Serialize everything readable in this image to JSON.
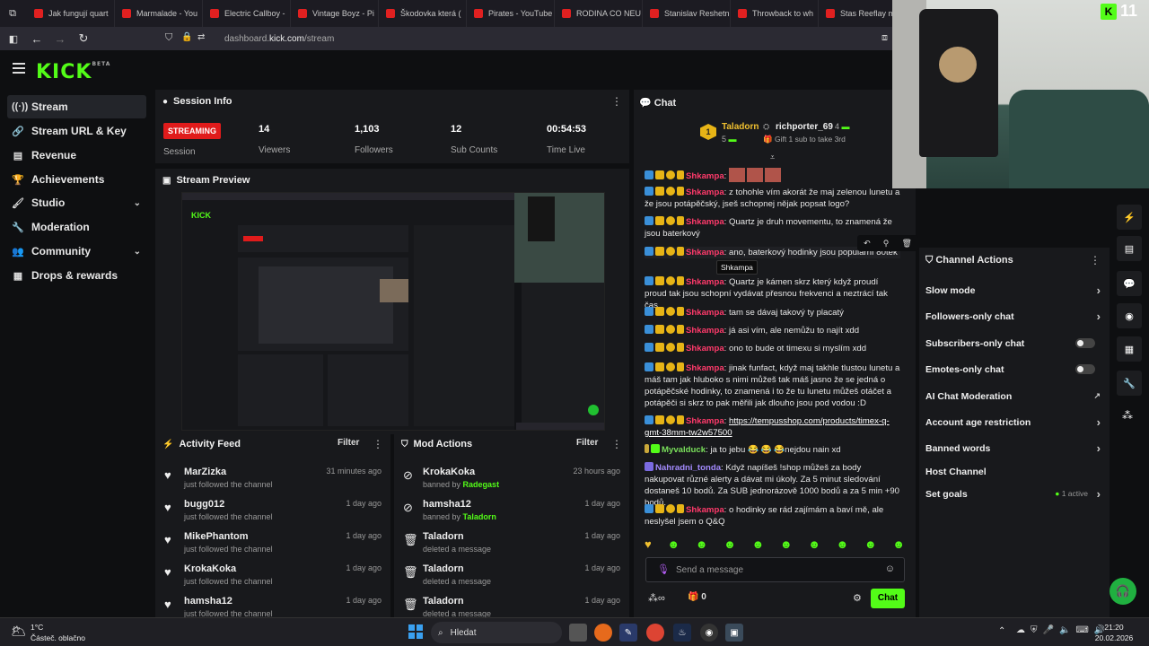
{
  "tabs": [
    {
      "label": "Jak fungují quart",
      "color": "#e02020"
    },
    {
      "label": "Marmalade - You",
      "color": "#e02020"
    },
    {
      "label": "Electric Callboy -",
      "color": "#e02020"
    },
    {
      "label": "Vintage Boyz - Pi",
      "color": "#e02020"
    },
    {
      "label": "Škodovka která (",
      "color": "#e02020"
    },
    {
      "label": "Pirates - YouTube",
      "color": "#e02020"
    },
    {
      "label": "RODINA CO NEU",
      "color": "#e02020"
    },
    {
      "label": "Stanislav Reshetn",
      "color": "#e02020"
    },
    {
      "label": "Throwback to wh",
      "color": "#e02020"
    },
    {
      "label": "Stas Reeflay muč",
      "color": "#e02020"
    },
    {
      "label": "Stream -",
      "color": "#53fc18"
    }
  ],
  "url": {
    "host": "dashboard.",
    "domain": "kick.com",
    "path": "/stream"
  },
  "logo": "KICK",
  "logo_badge": "BETA",
  "sidebar": {
    "items": [
      {
        "label": "Stream",
        "icon": "((·))"
      },
      {
        "label": "Stream URL & Key",
        "icon": "🔗"
      },
      {
        "label": "Revenue",
        "icon": "▤"
      },
      {
        "label": "Achievements",
        "icon": "🏆"
      },
      {
        "label": "Studio",
        "icon": "🖌"
      },
      {
        "label": "Moderation",
        "icon": "🔧"
      },
      {
        "label": "Community",
        "icon": "👥"
      },
      {
        "label": "Drops & rewards",
        "icon": "▦"
      }
    ]
  },
  "session": {
    "title": "Session Info",
    "status": "STREAMING",
    "status_label": "Session",
    "stats": [
      {
        "value": "14",
        "label": "Viewers"
      },
      {
        "value": "1,103",
        "label": "Followers"
      },
      {
        "value": "12",
        "label": "Sub Counts"
      },
      {
        "value": "00:54:53",
        "label": "Time Live"
      }
    ]
  },
  "preview": {
    "title": "Stream Preview"
  },
  "activity": {
    "title": "Activity Feed",
    "filter": "Filter",
    "items": [
      {
        "name": "MarZizka",
        "sub": "just followed the channel",
        "time": "31 minutes ago"
      },
      {
        "name": "bugg012",
        "sub": "just followed the channel",
        "time": "1 day ago"
      },
      {
        "name": "MikePhantom",
        "sub": "just followed the channel",
        "time": "1 day ago"
      },
      {
        "name": "KrokaKoka",
        "sub": "just followed the channel",
        "time": "1 day ago"
      },
      {
        "name": "hamsha12",
        "sub": "just followed the channel",
        "time": "1 day ago"
      }
    ]
  },
  "modactions": {
    "title": "Mod Actions",
    "filter": "Filter",
    "items": [
      {
        "name": "KrokaKoka",
        "pre": "banned by ",
        "by": "Radegast",
        "time": "23 hours ago",
        "icon": "⊘"
      },
      {
        "name": "hamsha12",
        "pre": "banned by ",
        "by": "Taladorn",
        "time": "1 day ago",
        "icon": "⊘"
      },
      {
        "name": "Taladorn",
        "pre": "deleted a message",
        "by": "",
        "time": "1 day ago",
        "icon": "🗑"
      },
      {
        "name": "Taladorn",
        "pre": "deleted a message",
        "by": "",
        "time": "1 day ago",
        "icon": "🗑"
      },
      {
        "name": "Taladorn",
        "pre": "deleted a message",
        "by": "",
        "time": "1 day ago",
        "icon": "🗑"
      }
    ]
  },
  "chat": {
    "title": "Chat",
    "leader1": {
      "name": "Taladorn",
      "count": "5",
      "rank": "1"
    },
    "leader2": {
      "name": "richporter_69",
      "count": "4",
      "note": "Gift 1 sub to take 3rd"
    },
    "tooltip": "Shkampa",
    "messages": [
      {
        "user": "Shkampa",
        "text": ": "
      },
      {
        "user": "Shkampa",
        "text": ": z tohohle vím akorát že maj zelenou lunetu a že jsou potápěčský, jseš schopnej nějak popsat logo?"
      },
      {
        "user": "Shkampa",
        "text": ": Quartz je druh movementu, to znamená že jsou baterkový"
      },
      {
        "user": "Shkampa",
        "text": ": ano, baterkový hodinky jsou populární 80tek"
      },
      {
        "user": "Shkampa",
        "text": ": Quartz je kámen skrz který když proudí proud tak jsou schopní vydávat přesnou frekvenci a neztrácí tak čas"
      },
      {
        "user": "Shkampa",
        "text": ": tam se dávaj takový ty placatý"
      },
      {
        "user": "Shkampa",
        "text": ": já asi vím, ale nemůžu to najít xdd"
      },
      {
        "user": "Shkampa",
        "text": ": ono to bude ot timexu si myslím xdd"
      },
      {
        "user": "Shkampa",
        "text": ": jinak funfact, když maj takhle tlustou lunetu a máš tam jak hluboko s nimi můžeš tak máš jasno že se jedná o potápěčské hodinky, to znamená i to že tu lunetu můžeš otáčet a potápěči si skrz to pak měřili jak dlouho jsou pod vodou :D"
      },
      {
        "user": "Shkampa",
        "text": ": ",
        "link": "https://tempusshop.com/products/timex-q-gmt-38mm-tw2w57500"
      },
      {
        "user": "Myvalduck",
        "text": ": ja to jebu 😂 😂 😂nejdou nain xd"
      },
      {
        "user": "Nahradni_tonda",
        "text": ": Když napíšeš !shop můžeš za body nakupovat různé alerty a dávat mi úkoly. Za 5 minut sledování dostaneš 10 bodů. Za SUB jednorázově 1000 bodů a za 5 min +90 bodů."
      },
      {
        "user": "Shkampa",
        "text": ": o hodinky se rád zajímám a baví mě, ale neslyšel jsem o Q&Q"
      }
    ],
    "placeholder": "Send a message",
    "points": "0",
    "send": "Chat"
  },
  "channel_actions": {
    "title": "Channel Actions",
    "items": [
      {
        "label": "Slow mode",
        "kind": "chev"
      },
      {
        "label": "Followers-only chat",
        "kind": "chev"
      },
      {
        "label": "Subscribers-only chat",
        "kind": "toggle"
      },
      {
        "label": "Emotes-only chat",
        "kind": "toggle"
      },
      {
        "label": "AI Chat Moderation",
        "kind": "ext"
      },
      {
        "label": "Account age restriction",
        "kind": "chev"
      },
      {
        "label": "Banned words",
        "kind": "chev"
      },
      {
        "label": "Host Channel",
        "kind": "none"
      },
      {
        "label": "Set goals",
        "kind": "chev",
        "note": "1 active"
      }
    ]
  },
  "webcam_badge": "11",
  "taskbar": {
    "weather_temp": "1°C",
    "weather_text": "Částeč. oblačno",
    "search": "Hledat",
    "time": "21:20",
    "date": "20.02.2026"
  }
}
